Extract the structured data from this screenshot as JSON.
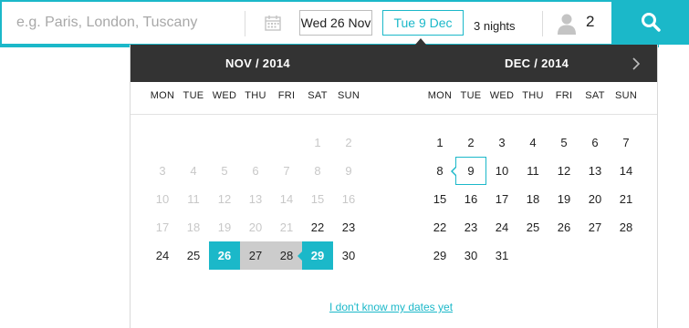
{
  "search": {
    "destination_placeholder": "e.g. Paris, London, Tuscany",
    "destination_value": "",
    "checkin_label": "Wed 26 Nov",
    "checkout_label": "Tue 9 Dec",
    "nights_label": "3 nights",
    "guests_count": "2",
    "icons": {
      "calendar": "calendar-icon",
      "guest": "person-icon",
      "search": "magnifier-icon",
      "next": "chevron-right-icon"
    }
  },
  "colors": {
    "accent": "#1bb8c9",
    "header_bg": "#333333",
    "range_bg": "#cccccc",
    "past_text": "#c8c8c8"
  },
  "calendar": {
    "weekdays": [
      "MON",
      "TUE",
      "WED",
      "THU",
      "FRI",
      "SAT",
      "SUN"
    ],
    "months": [
      {
        "title": "NOV / 2014",
        "weeks": [
          [
            {
              "d": ""
            },
            {
              "d": ""
            },
            {
              "d": ""
            },
            {
              "d": ""
            },
            {
              "d": ""
            },
            {
              "d": "1",
              "s": "past"
            },
            {
              "d": "2",
              "s": "past"
            }
          ],
          [
            {
              "d": "3",
              "s": "past"
            },
            {
              "d": "4",
              "s": "past"
            },
            {
              "d": "5",
              "s": "past"
            },
            {
              "d": "6",
              "s": "past"
            },
            {
              "d": "7",
              "s": "past"
            },
            {
              "d": "8",
              "s": "past"
            },
            {
              "d": "9",
              "s": "past"
            }
          ],
          [
            {
              "d": "10",
              "s": "past"
            },
            {
              "d": "11",
              "s": "past"
            },
            {
              "d": "12",
              "s": "past"
            },
            {
              "d": "13",
              "s": "past"
            },
            {
              "d": "14",
              "s": "past"
            },
            {
              "d": "15",
              "s": "past"
            },
            {
              "d": "16",
              "s": "past"
            }
          ],
          [
            {
              "d": "17",
              "s": "past"
            },
            {
              "d": "18",
              "s": "past"
            },
            {
              "d": "19",
              "s": "past"
            },
            {
              "d": "20",
              "s": "past"
            },
            {
              "d": "21",
              "s": "past"
            },
            {
              "d": "22"
            },
            {
              "d": "23"
            }
          ],
          [
            {
              "d": "24"
            },
            {
              "d": "25"
            },
            {
              "d": "26",
              "s": "selected"
            },
            {
              "d": "27",
              "s": "range"
            },
            {
              "d": "28",
              "s": "range"
            },
            {
              "d": "29",
              "s": "selected-end"
            },
            {
              "d": "30"
            }
          ]
        ]
      },
      {
        "title": "DEC / 2014",
        "weeks": [
          [
            {
              "d": "1"
            },
            {
              "d": "2"
            },
            {
              "d": "3"
            },
            {
              "d": "4"
            },
            {
              "d": "5"
            },
            {
              "d": "6"
            },
            {
              "d": "7"
            }
          ],
          [
            {
              "d": "8"
            },
            {
              "d": "9",
              "s": "outlined"
            },
            {
              "d": "10"
            },
            {
              "d": "11"
            },
            {
              "d": "12"
            },
            {
              "d": "13"
            },
            {
              "d": "14"
            }
          ],
          [
            {
              "d": "15"
            },
            {
              "d": "16"
            },
            {
              "d": "17"
            },
            {
              "d": "18"
            },
            {
              "d": "19"
            },
            {
              "d": "20"
            },
            {
              "d": "21"
            }
          ],
          [
            {
              "d": "22"
            },
            {
              "d": "23"
            },
            {
              "d": "24"
            },
            {
              "d": "25"
            },
            {
              "d": "26"
            },
            {
              "d": "27"
            },
            {
              "d": "28"
            }
          ],
          [
            {
              "d": "29"
            },
            {
              "d": "30"
            },
            {
              "d": "31"
            },
            {
              "d": ""
            },
            {
              "d": ""
            },
            {
              "d": ""
            },
            {
              "d": ""
            }
          ]
        ]
      }
    ],
    "unknown_dates_link": "I don't know my dates yet"
  }
}
